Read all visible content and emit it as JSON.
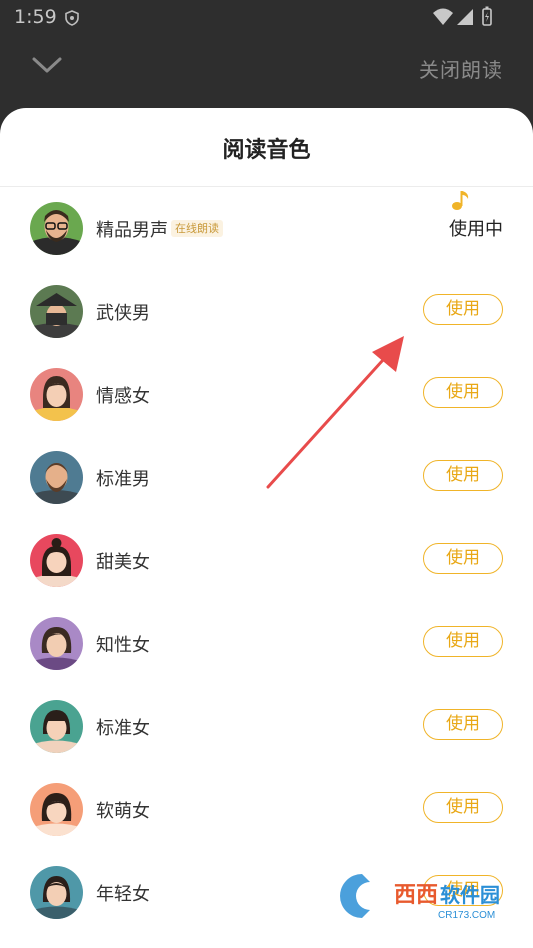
{
  "status_bar": {
    "time": "1:59"
  },
  "top_bar": {
    "close_reading": "关闭朗读"
  },
  "sheet": {
    "title": "阅读音色"
  },
  "voices": [
    {
      "name": "精品男声",
      "badge": "在线朗读",
      "state": "使用中",
      "avatar": "glasses-man"
    },
    {
      "name": "武侠男",
      "action": "使用",
      "avatar": "swordsman"
    },
    {
      "name": "情感女",
      "action": "使用",
      "avatar": "woman-pink"
    },
    {
      "name": "标准男",
      "action": "使用",
      "avatar": "bearded-man"
    },
    {
      "name": "甜美女",
      "action": "使用",
      "avatar": "sweet-girl"
    },
    {
      "name": "知性女",
      "action": "使用",
      "avatar": "intellectual-woman"
    },
    {
      "name": "标准女",
      "action": "使用",
      "avatar": "standard-woman"
    },
    {
      "name": "软萌女",
      "action": "使用",
      "avatar": "cute-girl"
    },
    {
      "name": "年轻女",
      "action": "使用",
      "avatar": "young-woman"
    }
  ],
  "watermark": {
    "brand": "西西",
    "sub": "软件园",
    "url": "CR173.COM"
  },
  "colors": {
    "accent": "#f0b429",
    "arrow": "#e84b4b"
  }
}
